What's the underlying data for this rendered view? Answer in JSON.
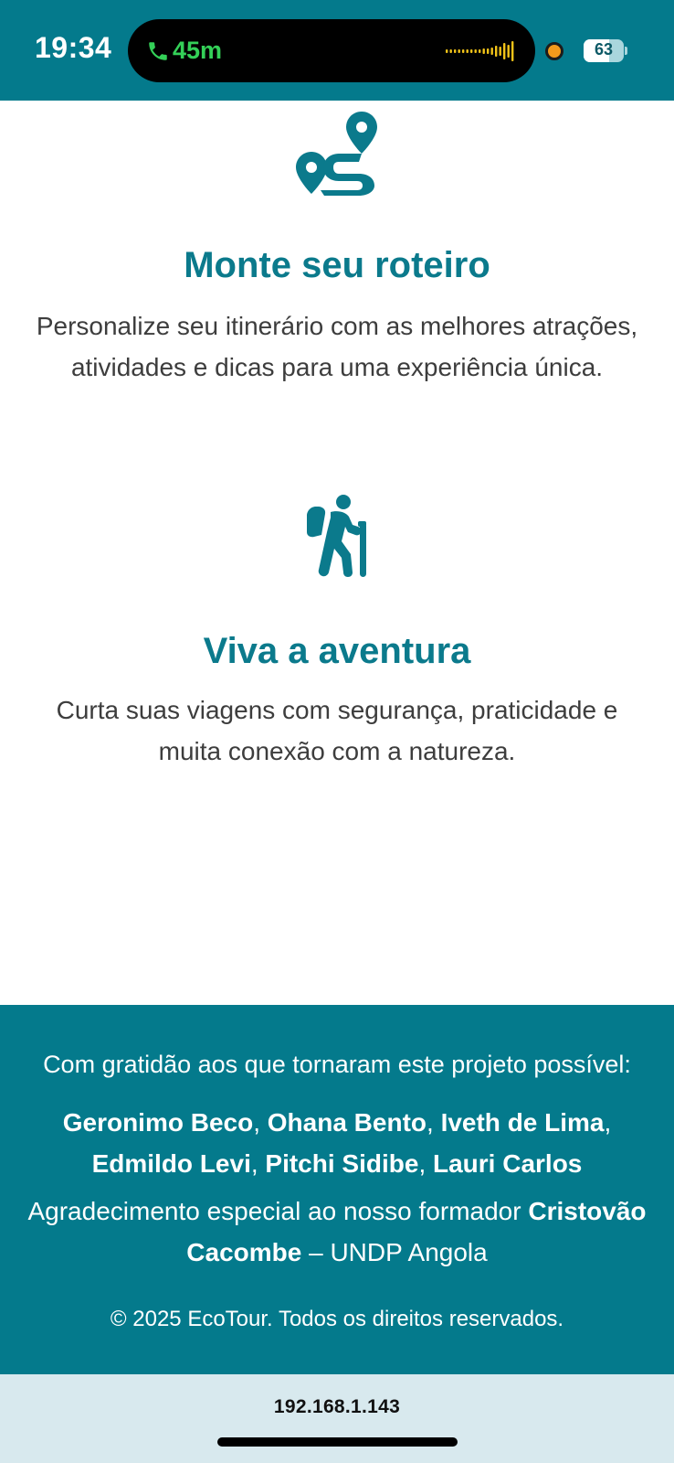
{
  "status_bar": {
    "time": "19:34",
    "call_duration": "45m",
    "battery_level": 63,
    "battery_label": "63",
    "accent_green": "#34d058",
    "recording_dot_color": "#f39a1c"
  },
  "features": [
    {
      "icon": "route-map-icon",
      "title": "Monte seu roteiro",
      "description": "Personalize seu itinerário com as melhores atrações, atividades e dicas para uma experiência única."
    },
    {
      "icon": "hiker-icon",
      "title": "Viva a aventura",
      "description": "Curta suas viagens com segurança, praticidade e muita conexão com a natureza."
    }
  ],
  "footer": {
    "thanks": "Com gratidão aos que tornaram este projeto possível:",
    "names": [
      "Geronimo Beco",
      "Ohana Bento",
      "Iveth de Lima",
      "Edmildo Levi",
      "Pitchi Sidibe",
      "Lauri Carlos"
    ],
    "separator": ", ",
    "special_prefix": "Agradecimento especial ao nosso formador ",
    "special_name": "Cristovão Cacombe",
    "special_suffix": " – UNDP Angola",
    "copyright": "© 2025 EcoTour. Todos os direitos reservados."
  },
  "browser": {
    "url": "192.168.1.143"
  },
  "colors": {
    "brand_teal": "#047a8c",
    "title_teal": "#0b7a8c",
    "url_bar_bg": "#d8e9ee"
  }
}
